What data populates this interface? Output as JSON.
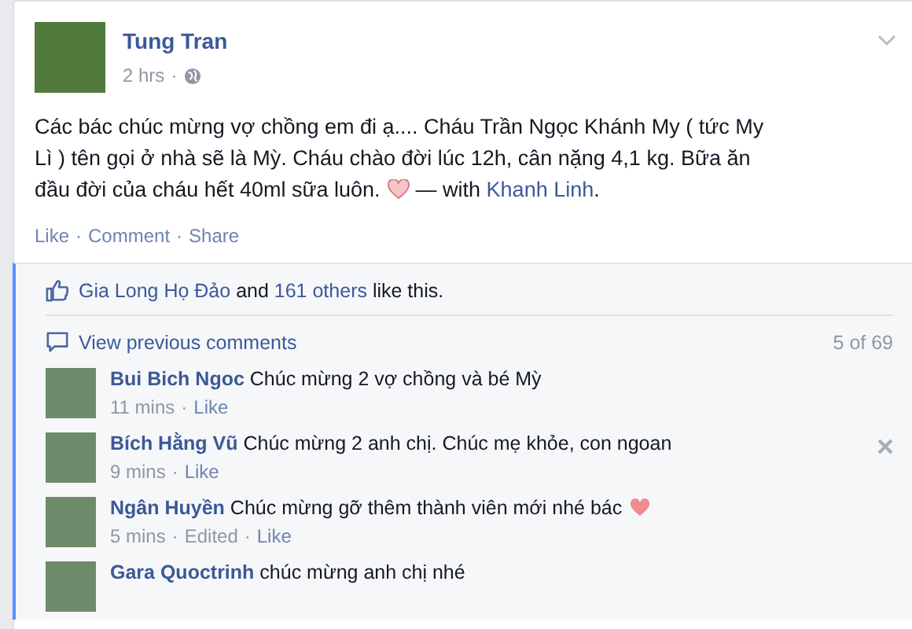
{
  "separator": "·",
  "post": {
    "author": "Tung Tran",
    "time": "2 hrs",
    "text": "Các bác chúc mừng vợ chồng em đi ạ.... Cháu Trần Ngọc Khánh My ( tức My\nLì ) tên gọi ở nhà sẽ là Mỳ. Cháu chào đời lúc 12h, cân nặng 4,1 kg. Bữa ăn\nđầu đời của cháu hết 40ml sữa luôn.",
    "with_prefix": "— with",
    "tagged": "Khanh Linh",
    "tagged_suffix": "."
  },
  "actions": [
    "Like",
    "Comment",
    "Share"
  ],
  "likes": {
    "name": "Gia Long Họ Đảo",
    "middle": "and",
    "others": "161 others",
    "suffix": "like this."
  },
  "comments_header": {
    "label": "View previous comments",
    "count": "5 of 69"
  },
  "comments": [
    {
      "name": "Bui Bich Ngoc",
      "text": "Chúc mừng 2 vợ chồng và bé Mỳ",
      "heart": false,
      "remove_button": false,
      "meta": [
        {
          "kind": "plain",
          "text": "11 mins"
        },
        {
          "kind": "link",
          "text": "Like"
        }
      ]
    },
    {
      "name": "Bích Hằng Vũ",
      "text": "Chúc mừng 2 anh chị. Chúc mẹ khỏe, con ngoan",
      "heart": false,
      "remove_button": true,
      "meta": [
        {
          "kind": "plain",
          "text": "9 mins"
        },
        {
          "kind": "link",
          "text": "Like"
        }
      ]
    },
    {
      "name": "Ngân Huyền",
      "text": "Chúc mừng gỡ thêm thành viên mới nhé bác",
      "heart": true,
      "remove_button": false,
      "meta": [
        {
          "kind": "plain",
          "text": "5 mins"
        },
        {
          "kind": "plain",
          "text": "Edited"
        },
        {
          "kind": "link",
          "text": "Like"
        }
      ]
    },
    {
      "name": "Gara Quoctrinh",
      "text": "chúc mừng anh chị nhé",
      "heart": false,
      "remove_button": false
    }
  ]
}
